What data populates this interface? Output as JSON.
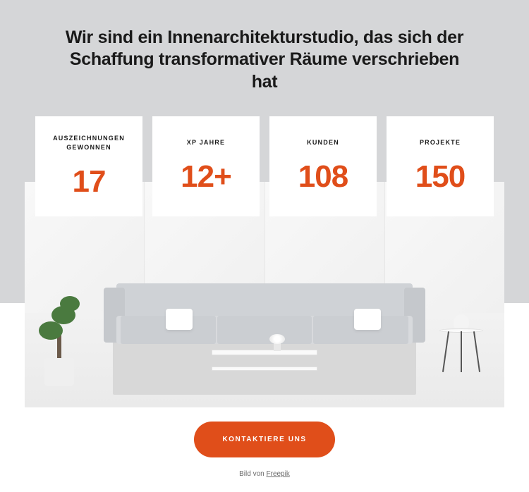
{
  "headline": "Wir sind ein Innenarchitekturstudio, das sich der Schaffung transformativer Räume verschrieben hat",
  "stats": [
    {
      "label": "AUSZEICHNUNGEN GEWONNEN",
      "value": "17"
    },
    {
      "label": "XP JAHRE",
      "value": "12+"
    },
    {
      "label": "KUNDEN",
      "value": "108"
    },
    {
      "label": "PROJEKTE",
      "value": "150"
    }
  ],
  "cta": {
    "label": "KONTAKTIERE UNS"
  },
  "credit": {
    "prefix": "Bild von ",
    "link_text": "Freepik"
  },
  "colors": {
    "accent": "#e04e1a"
  }
}
